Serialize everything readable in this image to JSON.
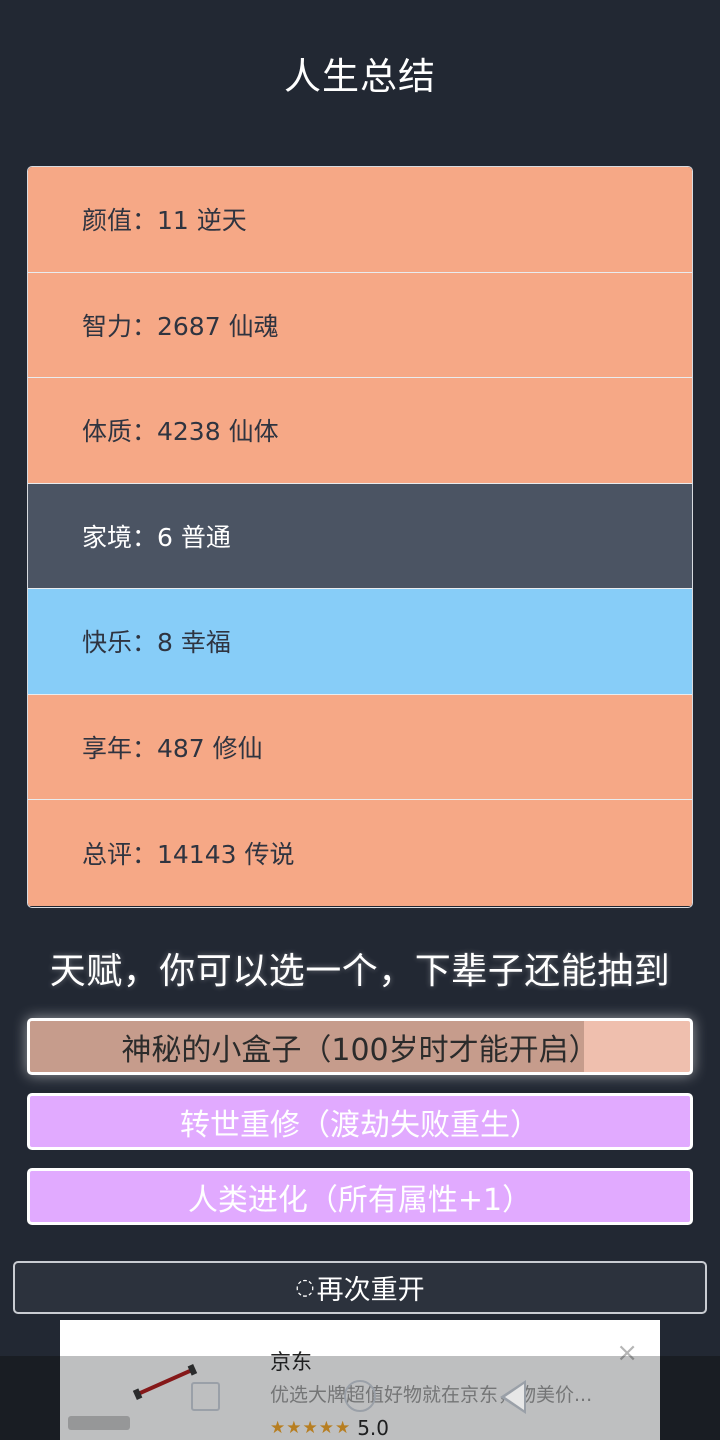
{
  "page_title": "人生总结",
  "stats": [
    {
      "text": "颜值：11 逆天",
      "tone": "orange"
    },
    {
      "text": "智力：2687 仙魂",
      "tone": "orange"
    },
    {
      "text": "体质：4238 仙体",
      "tone": "orange"
    },
    {
      "text": "家境：6 普通",
      "tone": "dark"
    },
    {
      "text": "快乐：8 幸福",
      "tone": "blue"
    },
    {
      "text": "享年：487 修仙",
      "tone": "orange"
    },
    {
      "text": "总评：14143 传说",
      "tone": "orange"
    }
  ],
  "talent_heading": "天赋，你可以选一个，下辈子还能抽到",
  "talents": [
    {
      "label": "神秘的小盒子（100岁时才能开启）",
      "selected": true,
      "progress": 0.84
    },
    {
      "label": "转世重修（渡劫失败重生）",
      "selected": false
    },
    {
      "label": "人类进化（所有属性+1）",
      "selected": false
    }
  ],
  "restart": {
    "icon": "refresh-icon",
    "glyph": "◌",
    "label": "再次重开"
  },
  "ad": {
    "name": "京东",
    "description": "优选大牌超值好物就在京东，物美价...",
    "stars": "★★★★★",
    "rating": "5.0",
    "close_glyph": "×"
  },
  "colors": {
    "background": "#222833",
    "stat_orange": "#f6a886",
    "stat_dark": "#4b5463",
    "stat_blue": "#87cdf8",
    "talent_purple": "#e1aaff",
    "talent_selected": "#efbfae"
  }
}
